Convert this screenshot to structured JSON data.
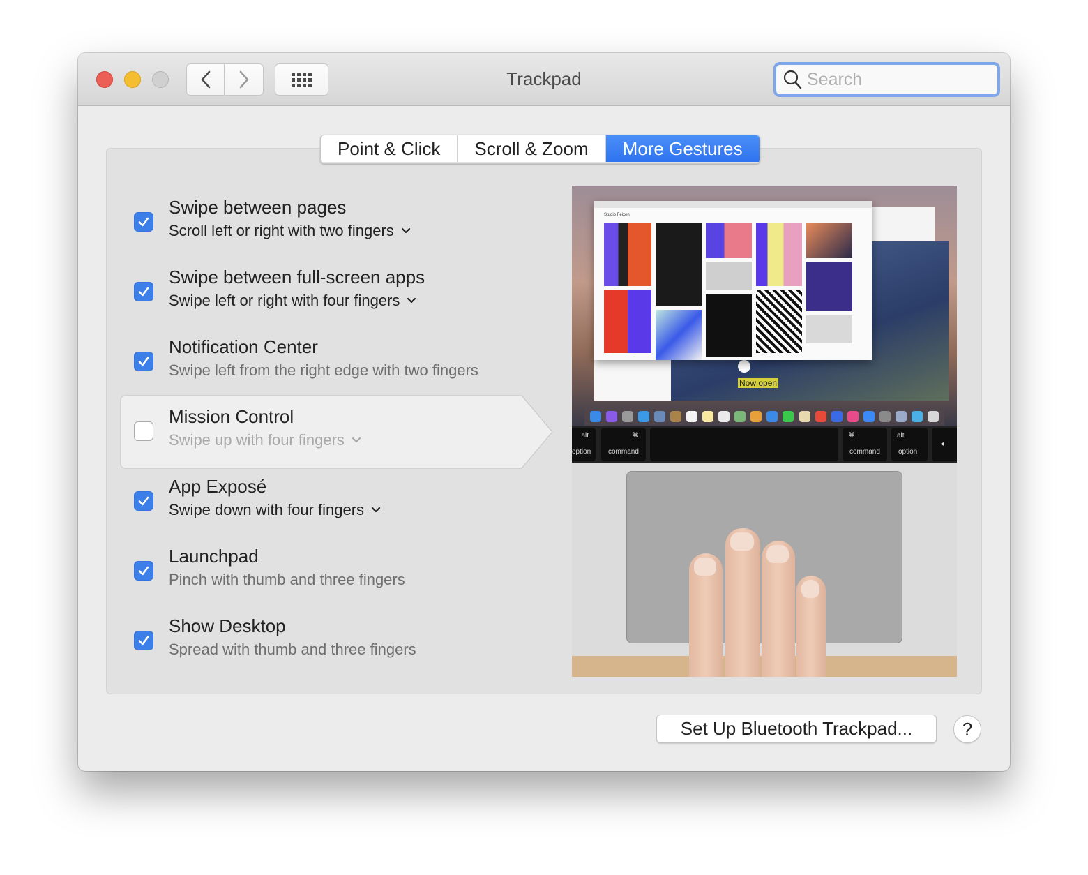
{
  "window": {
    "title": "Trackpad",
    "search": {
      "placeholder": "Search",
      "value": ""
    }
  },
  "tabs": [
    {
      "label": "Point & Click",
      "active": false
    },
    {
      "label": "Scroll & Zoom",
      "active": false
    },
    {
      "label": "More Gestures",
      "active": true
    }
  ],
  "gestures": [
    {
      "title": "Swipe between pages",
      "subtitle": "Scroll left or right with two fingers",
      "checked": true,
      "has_dropdown": true
    },
    {
      "title": "Swipe between full-screen apps",
      "subtitle": "Swipe left or right with four fingers",
      "checked": true,
      "has_dropdown": true
    },
    {
      "title": "Notification Center",
      "subtitle": "Swipe left from the right edge with two fingers",
      "checked": true,
      "has_dropdown": false
    },
    {
      "title": "Mission Control",
      "subtitle": "Swipe up with four fingers",
      "checked": false,
      "has_dropdown": true,
      "selected": true
    },
    {
      "title": "App Exposé",
      "subtitle": "Swipe down with four fingers",
      "checked": true,
      "has_dropdown": true
    },
    {
      "title": "Launchpad",
      "subtitle": "Pinch with thumb and three fingers",
      "checked": true,
      "has_dropdown": false
    },
    {
      "title": "Show Desktop",
      "subtitle": "Spread with thumb and three fingers",
      "checked": true,
      "has_dropdown": false
    }
  ],
  "preview": {
    "site_title": "Studio Feixen",
    "banner_text": "Now open",
    "keys": {
      "left_option": {
        "top": "alt",
        "bottom": "option"
      },
      "left_command": {
        "top": "⌘",
        "bottom": "command"
      },
      "right_command": {
        "top": "⌘",
        "bottom": "command"
      },
      "right_option": {
        "top": "alt",
        "bottom": "option"
      },
      "arrow": "◂"
    }
  },
  "footer": {
    "bluetooth_button": "Set Up Bluetooth Trackpad...",
    "help_button": "?"
  },
  "colors": {
    "accent": "#3d7fe8",
    "close": "#ec5f57",
    "minimize": "#f5bd30",
    "zoom_disabled": "#d0d0d0",
    "search_focus_ring": "#7ea6e8"
  }
}
